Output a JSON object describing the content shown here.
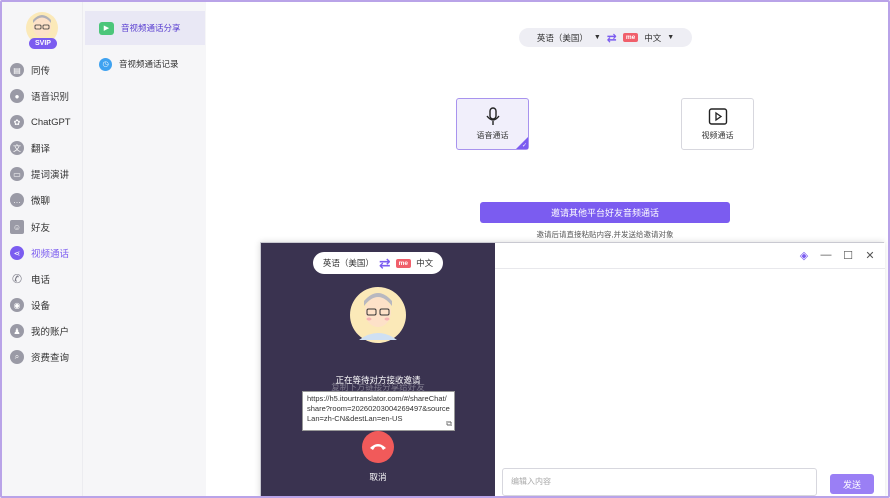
{
  "profile": {
    "badge": "SVIP"
  },
  "sidebar": {
    "items": [
      {
        "label": "同传",
        "icon": "simultaneous-icon"
      },
      {
        "label": "语音识别",
        "icon": "mic-icon"
      },
      {
        "label": "ChatGPT",
        "icon": "chatgpt-icon"
      },
      {
        "label": "翻译",
        "icon": "translate-icon"
      },
      {
        "label": "提词演讲",
        "icon": "teleprompter-icon"
      },
      {
        "label": "微聊",
        "icon": "chat-icon"
      },
      {
        "label": "好友",
        "icon": "friends-icon"
      },
      {
        "label": "视频通话",
        "icon": "video-call-icon",
        "active": true
      },
      {
        "label": "电话",
        "icon": "phone-icon"
      },
      {
        "label": "设备",
        "icon": "device-icon"
      },
      {
        "label": "我的账户",
        "icon": "account-icon"
      },
      {
        "label": "资费查询",
        "icon": "search-icon"
      }
    ]
  },
  "submenu": {
    "items": [
      {
        "label": "音视频通话分享",
        "active": true
      },
      {
        "label": "音视频通话记录"
      }
    ]
  },
  "main": {
    "source_lang": "英语（美国）",
    "target_lang": "中文",
    "me_badge": "me",
    "modes": [
      {
        "label": "语音通话",
        "selected": true
      },
      {
        "label": "视频通话"
      }
    ],
    "invite_button": "邀请其他平台好友音频通话",
    "invite_hint": "邀请后请直接粘贴内容,并发送给邀请对象"
  },
  "overlay": {
    "source_lang": "英语（美国）",
    "target_lang": "中文",
    "me_badge": "me",
    "waiting_text": "正在等待对方接收邀请",
    "waiting_shadow": "复制下方链接分享给好友",
    "link": "https://h5.itourtranslator.com/#/shareChat/share?room=20260203004269497&sourceLan=zh-CN&destLan=en-US",
    "cancel_label": "取消",
    "input_placeholder": "编辑入内容",
    "send_button": "发送"
  },
  "colors": {
    "accent": "#7b5cf0",
    "hangup": "#f15a5a",
    "panel": "#3a3350"
  }
}
